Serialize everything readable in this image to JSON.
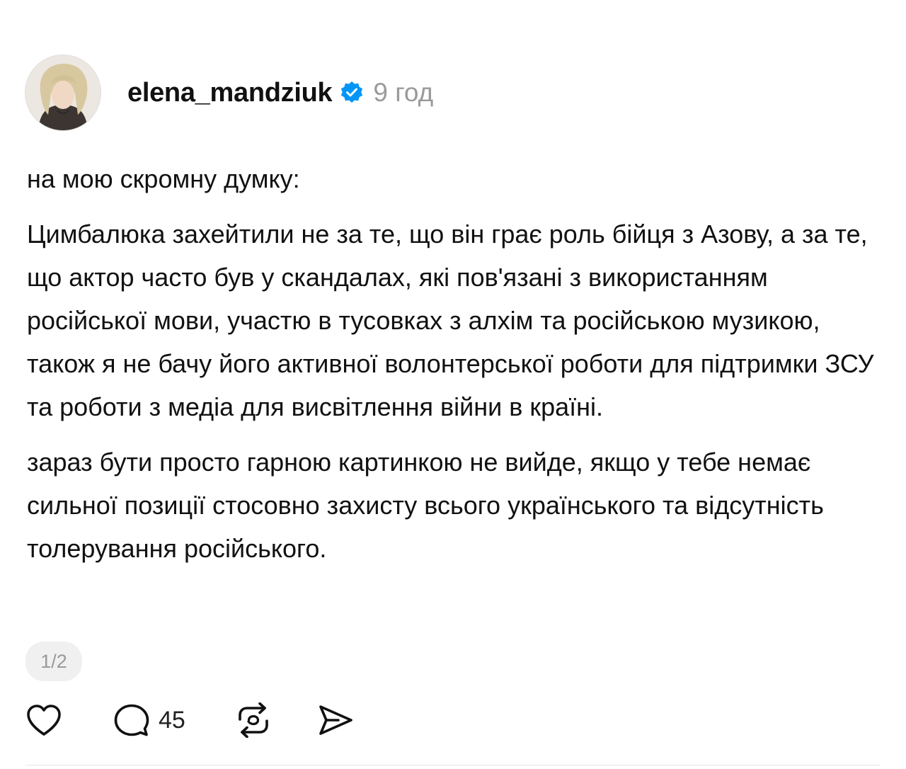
{
  "post": {
    "author": {
      "username": "elena_mandziuk",
      "verified": true
    },
    "timestamp": "9 год",
    "paragraphs": [
      "на мою скромну думку:",
      "Цимбалюка захейтили не за те, що він грає роль бійця з Азову, а за те, що актор часто був у скандалах, які пов'язані з використанням російської мови, участю в тусовках з алхім та російською музикою, також я не бачу його активної волонтерської роботи для підтримки ЗСУ та роботи з медіа для висвітлення війни в країні.",
      "зараз бути просто гарною картинкою не вийде, якщо у тебе немає сильної позиції стосовно захисту всього українського та відсутність толерування російського."
    ],
    "page_indicator": "1/2",
    "actions": {
      "comments_count": "45"
    }
  },
  "colors": {
    "verified_badge": "#0095f6",
    "muted_text": "#9a9a9a",
    "text": "#111111"
  },
  "icons": {
    "like": "heart-icon",
    "comment": "comment-icon",
    "repost": "repost-icon",
    "share": "send-icon",
    "verified": "verified-badge-icon"
  }
}
